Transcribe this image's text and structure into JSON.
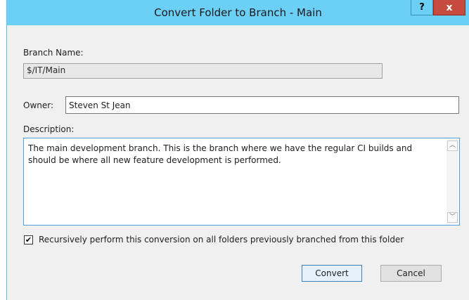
{
  "dialog": {
    "title": "Convert Folder to Branch - Main",
    "help_button": "?",
    "close_button": "x"
  },
  "branch_name": {
    "label": "Branch Name:",
    "value": "$/IT/Main"
  },
  "owner": {
    "label": "Owner:",
    "value": "Steven St Jean"
  },
  "description": {
    "label": "Description:",
    "value": "The main development branch. This is the branch where we have the regular CI builds and should be where all new feature development is performed."
  },
  "recursive": {
    "checked": true,
    "check_glyph": "✔",
    "label": "Recursively perform this conversion on all folders previously branched from this folder"
  },
  "buttons": {
    "convert": "Convert",
    "cancel": "Cancel"
  },
  "icons": {
    "scroll_up": "︿",
    "scroll_down": "﹀"
  }
}
